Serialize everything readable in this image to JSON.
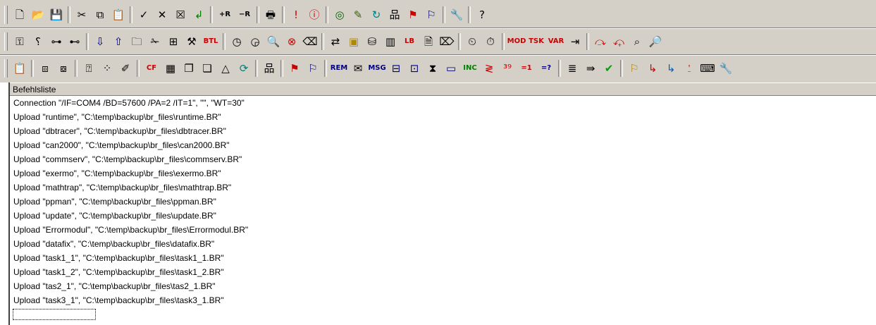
{
  "toolbar_rows": [
    [
      {
        "name": "new-file",
        "glyph": "🗋"
      },
      {
        "name": "open-folder",
        "glyph": "📂"
      },
      {
        "name": "save",
        "glyph": "💾"
      },
      {
        "sep": true
      },
      {
        "name": "cut",
        "glyph": "✂"
      },
      {
        "name": "copy",
        "glyph": "⧉"
      },
      {
        "name": "paste",
        "glyph": "📋"
      },
      {
        "sep": true
      },
      {
        "name": "check",
        "glyph": "✓"
      },
      {
        "name": "delete-x",
        "glyph": "✕"
      },
      {
        "name": "box-x",
        "glyph": "☒"
      },
      {
        "name": "enter-arrow",
        "glyph": "↲",
        "color": "#008000"
      },
      {
        "sep": true
      },
      {
        "name": "add-r",
        "glyph": "+R",
        "text": true
      },
      {
        "name": "remove-r",
        "glyph": "−R",
        "text": true
      },
      {
        "sep": true
      },
      {
        "name": "print",
        "glyph": "🖶"
      },
      {
        "sep": true
      },
      {
        "name": "exclamation",
        "glyph": "!",
        "color": "#cc0000"
      },
      {
        "name": "alert-circle",
        "glyph": "ⓘ",
        "color": "#cc0000"
      },
      {
        "sep": true
      },
      {
        "name": "globe",
        "glyph": "◎",
        "color": "#006600"
      },
      {
        "name": "pencil",
        "glyph": "✎",
        "color": "#336600"
      },
      {
        "name": "refresh-cycle",
        "glyph": "↻",
        "color": "#008080"
      },
      {
        "name": "network",
        "glyph": "品"
      },
      {
        "name": "download-flag",
        "glyph": "⚑",
        "color": "#cc0000"
      },
      {
        "name": "upload-flag",
        "glyph": "⚐",
        "color": "#000080"
      },
      {
        "sep": true
      },
      {
        "name": "tools",
        "glyph": "🔧"
      },
      {
        "sep": true
      },
      {
        "name": "help",
        "glyph": "?"
      }
    ],
    [
      {
        "name": "key",
        "glyph": "⚿"
      },
      {
        "name": "node-query",
        "glyph": "⸮"
      },
      {
        "name": "tree-branch",
        "glyph": "⊶"
      },
      {
        "name": "network-alt",
        "glyph": "⊷"
      },
      {
        "sep": true
      },
      {
        "name": "arrow-down",
        "glyph": "⇩",
        "color": "#000080"
      },
      {
        "name": "arrow-up",
        "glyph": "⇧",
        "color": "#000080"
      },
      {
        "name": "folder-br",
        "glyph": "🗀"
      },
      {
        "name": "scissors-alt",
        "glyph": "✁"
      },
      {
        "name": "chip-add",
        "glyph": "⊞"
      },
      {
        "name": "tools-alt",
        "glyph": "⚒"
      },
      {
        "name": "btl",
        "glyph": "BTL",
        "text": true,
        "color": "#cc0000"
      },
      {
        "sep": true
      },
      {
        "name": "clock-check",
        "glyph": "◷"
      },
      {
        "name": "clock-alt",
        "glyph": "◶"
      },
      {
        "name": "search",
        "glyph": "🔍"
      },
      {
        "name": "stop-circle",
        "glyph": "⊗",
        "color": "#cc0000"
      },
      {
        "name": "eraser",
        "glyph": "⌫"
      },
      {
        "sep": true
      },
      {
        "name": "connect",
        "glyph": "⇄"
      },
      {
        "name": "timer-box",
        "glyph": "▣",
        "color": "#b08800"
      },
      {
        "name": "database",
        "glyph": "⛁"
      },
      {
        "name": "chart-bars",
        "glyph": "▥"
      },
      {
        "name": "lb-box",
        "glyph": "LB",
        "text": true,
        "color": "#cc0000"
      },
      {
        "name": "document-edit",
        "glyph": "🗎"
      },
      {
        "name": "eraser-alt",
        "glyph": "⌦"
      },
      {
        "sep": true
      },
      {
        "name": "time-node",
        "glyph": "⏲"
      },
      {
        "name": "time-node-alt",
        "glyph": "⏱"
      },
      {
        "sep": true
      },
      {
        "name": "mod",
        "glyph": "MOD",
        "text": true,
        "color": "#cc0000"
      },
      {
        "name": "tsk",
        "glyph": "TSK",
        "text": true,
        "color": "#cc0000"
      },
      {
        "name": "var",
        "glyph": "VAR",
        "text": true,
        "color": "#cc0000"
      },
      {
        "name": "export",
        "glyph": "⇥"
      },
      {
        "sep": true
      },
      {
        "name": "pipette",
        "glyph": "⤼",
        "color": "#cc0000"
      },
      {
        "name": "pipette-alt",
        "glyph": "⤽",
        "color": "#cc0000"
      },
      {
        "name": "network-search",
        "glyph": "⌕"
      },
      {
        "name": "zoom",
        "glyph": "🔎"
      }
    ],
    [
      {
        "name": "clipboard-list",
        "glyph": "📋"
      },
      {
        "sep": true
      },
      {
        "name": "image-link",
        "glyph": "⧈"
      },
      {
        "name": "image-broken",
        "glyph": "⧇"
      },
      {
        "sep": true
      },
      {
        "name": "query-node",
        "glyph": "⍰"
      },
      {
        "name": "dots",
        "glyph": "⁘"
      },
      {
        "name": "pen-edit",
        "glyph": "✐"
      },
      {
        "sep": true
      },
      {
        "name": "cf",
        "glyph": "CF",
        "text": true,
        "color": "#cc0000"
      },
      {
        "name": "doc-grid",
        "glyph": "▦"
      },
      {
        "name": "copy-doc",
        "glyph": "❐"
      },
      {
        "name": "copy-doc-alt",
        "glyph": "❏"
      },
      {
        "name": "draw-tool",
        "glyph": "△"
      },
      {
        "name": "refresh-alt",
        "glyph": "⟳",
        "color": "#008080"
      },
      {
        "sep": true
      },
      {
        "name": "network-tree",
        "glyph": "品"
      },
      {
        "sep": true
      },
      {
        "name": "flag-down",
        "glyph": "⚑",
        "color": "#cc0000"
      },
      {
        "name": "flag-up",
        "glyph": "⚐",
        "color": "#000080"
      },
      {
        "sep": true
      },
      {
        "name": "rem",
        "glyph": "REM",
        "text": true,
        "color": "#000080"
      },
      {
        "name": "envelope",
        "glyph": "✉"
      },
      {
        "name": "msg",
        "glyph": "MSG",
        "text": true,
        "color": "#000080"
      },
      {
        "name": "window-down",
        "glyph": "⊟",
        "color": "#000080"
      },
      {
        "name": "window-grid",
        "glyph": "⊡",
        "color": "#000080"
      },
      {
        "name": "hourglass",
        "glyph": "⧗"
      },
      {
        "name": "window",
        "glyph": "▭",
        "color": "#000080"
      },
      {
        "name": "inc",
        "glyph": "INC",
        "text": true,
        "color": "#008000"
      },
      {
        "name": "compare",
        "glyph": "≷",
        "color": "#cc0000"
      },
      {
        "name": "jump-39",
        "glyph": "³⁹",
        "color": "#cc0000"
      },
      {
        "name": "assign-1",
        "glyph": "=1",
        "text": true,
        "color": "#cc0000"
      },
      {
        "name": "assign-query",
        "glyph": "=?",
        "text": true,
        "color": "#000080"
      },
      {
        "sep": true
      },
      {
        "name": "list-indent",
        "glyph": "≣"
      },
      {
        "name": "list-arrow",
        "glyph": "⇛"
      },
      {
        "name": "checkmark",
        "glyph": "✔",
        "color": "#00a000"
      },
      {
        "sep": true
      },
      {
        "name": "flag",
        "glyph": "⚐",
        "color": "#b08800"
      },
      {
        "name": "branch-query",
        "glyph": "↳",
        "color": "#cc0000"
      },
      {
        "name": "branch",
        "glyph": "↳",
        "color": "#0060c0"
      },
      {
        "name": "label",
        "glyph": "⍘",
        "color": "#cc0000"
      },
      {
        "name": "keyboard",
        "glyph": "⌨"
      },
      {
        "name": "wrench",
        "glyph": "🔧"
      }
    ]
  ],
  "list": {
    "header": "Befehlsliste",
    "lines": [
      "Connection \"/IF=COM4 /BD=57600 /PA=2 /IT=1\", \"\", \"WT=30\"",
      "Upload \"runtime\", \"C:\\temp\\backup\\br_files\\runtime.BR\"",
      "Upload \"dbtracer\", \"C:\\temp\\backup\\br_files\\dbtracer.BR\"",
      "Upload \"can2000\", \"C:\\temp\\backup\\br_files\\can2000.BR\"",
      "Upload \"commserv\", \"C:\\temp\\backup\\br_files\\commserv.BR\"",
      "Upload \"exermo\", \"C:\\temp\\backup\\br_files\\exermo.BR\"",
      "Upload \"mathtrap\", \"C:\\temp\\backup\\br_files\\mathtrap.BR\"",
      "Upload \"ppman\", \"C:\\temp\\backup\\br_files\\ppman.BR\"",
      "Upload \"update\", \"C:\\temp\\backup\\br_files\\update.BR\"",
      "Upload \"Errormodul\", \"C:\\temp\\backup\\br_files\\Errormodul.BR\"",
      "Upload \"datafix\", \"C:\\temp\\backup\\br_files\\datafix.BR\"",
      "Upload \"task1_1\", \"C:\\temp\\backup\\br_files\\task1_1.BR\"",
      "Upload \"task1_2\", \"C:\\temp\\backup\\br_files\\task1_2.BR\"",
      "Upload \"tas2_1\", \"C:\\temp\\backup\\br_files\\tas2_1.BR\"",
      "Upload \"task3_1\", \"C:\\temp\\backup\\br_files\\task3_1.BR\""
    ]
  }
}
